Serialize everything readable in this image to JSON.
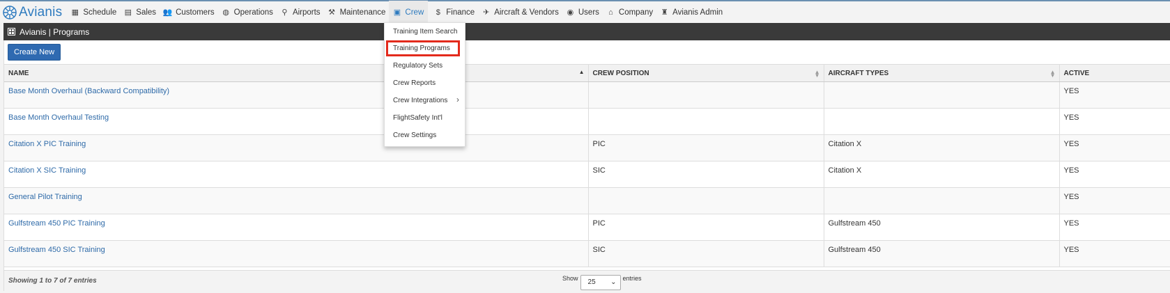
{
  "brand": {
    "name": "Avianis"
  },
  "nav": [
    {
      "label": "Schedule",
      "icon": "calendar-icon"
    },
    {
      "label": "Sales",
      "icon": "document-icon"
    },
    {
      "label": "Customers",
      "icon": "users-icon"
    },
    {
      "label": "Operations",
      "icon": "globe-icon"
    },
    {
      "label": "Airports",
      "icon": "map-pin-icon"
    },
    {
      "label": "Maintenance",
      "icon": "wrench-icon"
    },
    {
      "label": "Crew",
      "icon": "id-card-icon"
    },
    {
      "label": "Finance",
      "icon": "dollar-icon"
    },
    {
      "label": "Aircraft & Vendors",
      "icon": "plane-icon"
    },
    {
      "label": "Users",
      "icon": "user-circle-icon"
    },
    {
      "label": "Company",
      "icon": "bank-icon"
    },
    {
      "label": "Avianis Admin",
      "icon": "building-icon"
    }
  ],
  "title_bar": {
    "title": "Avianis | Programs"
  },
  "toolbar": {
    "create_label": "Create New"
  },
  "table": {
    "columns": [
      "NAME",
      "CREW POSITION",
      "AIRCRAFT TYPES",
      "ACTIVE"
    ],
    "rows": [
      [
        "Base Month Overhaul (Backward Compatibility)",
        "",
        "",
        "YES"
      ],
      [
        "Base Month Overhaul Testing",
        "",
        "",
        "YES"
      ],
      [
        "Citation X PIC Training",
        "PIC",
        "Citation X",
        "YES"
      ],
      [
        "Citation X SIC Training",
        "SIC",
        "Citation X",
        "YES"
      ],
      [
        "General Pilot Training",
        "",
        "",
        "YES"
      ],
      [
        "Gulfstream 450 PIC Training",
        "PIC",
        "Gulfstream 450",
        "YES"
      ],
      [
        "Gulfstream 450 SIC Training",
        "SIC",
        "Gulfstream 450",
        "YES"
      ]
    ]
  },
  "footer": {
    "info": "Showing 1 to 7 of 7 entries",
    "show_label": "Show",
    "page_size": "25",
    "entries_label": "entries"
  },
  "crew_menu": {
    "items": [
      "Training Item Search",
      "Training Programs",
      "Regulatory Sets",
      "Crew Reports",
      "Crew Integrations",
      "FlightSafety Int'l",
      "Crew Settings"
    ],
    "highlighted": "Training Programs",
    "highlight_color": "#e32a1c"
  },
  "colors": {
    "accent": "#2e7bbf",
    "title_bar": "#3a3a3a",
    "button": "#2f6ab1"
  }
}
